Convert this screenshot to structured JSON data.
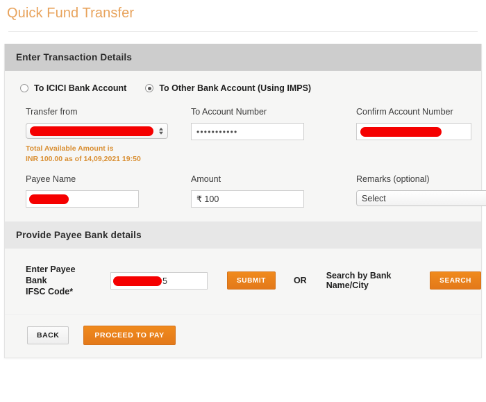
{
  "page": {
    "title": "Quick Fund Transfer"
  },
  "colors": {
    "title": "#e8a35c",
    "accent_orange": "#e8801a",
    "section_header_dark": "#cdcdcd",
    "section_header_light": "#e7e7e7",
    "note_orange": "#d98f33",
    "redaction_red": "#f50000",
    "body_background": "#f6f6f5"
  },
  "transaction_section": {
    "header": "Enter Transaction Details",
    "account_type_options": [
      {
        "label": "To ICICI Bank Account",
        "selected": false
      },
      {
        "label": "To Other Bank Account (Using IMPS)",
        "selected": true
      }
    ],
    "fields": {
      "transfer_from": {
        "label": "Transfer from",
        "value": "",
        "redacted": true,
        "control": "select",
        "note_line1": "Total Available Amount is",
        "note_line2": "INR 100.00 as of 14,09,2021 19:50"
      },
      "to_account_number": {
        "label": "To Account Number",
        "value": "•••••••••••",
        "masked": true,
        "control": "text"
      },
      "confirm_account_number": {
        "label": "Confirm Account Number",
        "value": "",
        "redacted": true,
        "control": "text"
      },
      "payee_name": {
        "label": "Payee Name",
        "value": "",
        "redacted": true,
        "control": "text"
      },
      "amount": {
        "label": "Amount",
        "value": "₹ 100",
        "control": "text"
      },
      "remarks": {
        "label": "Remarks (optional)",
        "value": "Select",
        "control": "select",
        "options": [
          "Select"
        ]
      }
    }
  },
  "payee_bank_section": {
    "header": "Provide Payee Bank details",
    "ifsc_label_line1": "Enter Payee Bank",
    "ifsc_label_line2": "IFSC Code*",
    "ifsc_value_visible": "5",
    "submit_label": "SUBMIT",
    "or_label": "OR",
    "search_by_label": "Search by Bank Name/City",
    "search_label": "SEARCH"
  },
  "footer": {
    "back_label": "BACK",
    "proceed_label": "PROCEED TO PAY"
  },
  "icons": {
    "stepper": "stepper-arrows-icon",
    "radio_unselected": "radio-unselected-icon",
    "radio_selected": "radio-selected-icon"
  }
}
